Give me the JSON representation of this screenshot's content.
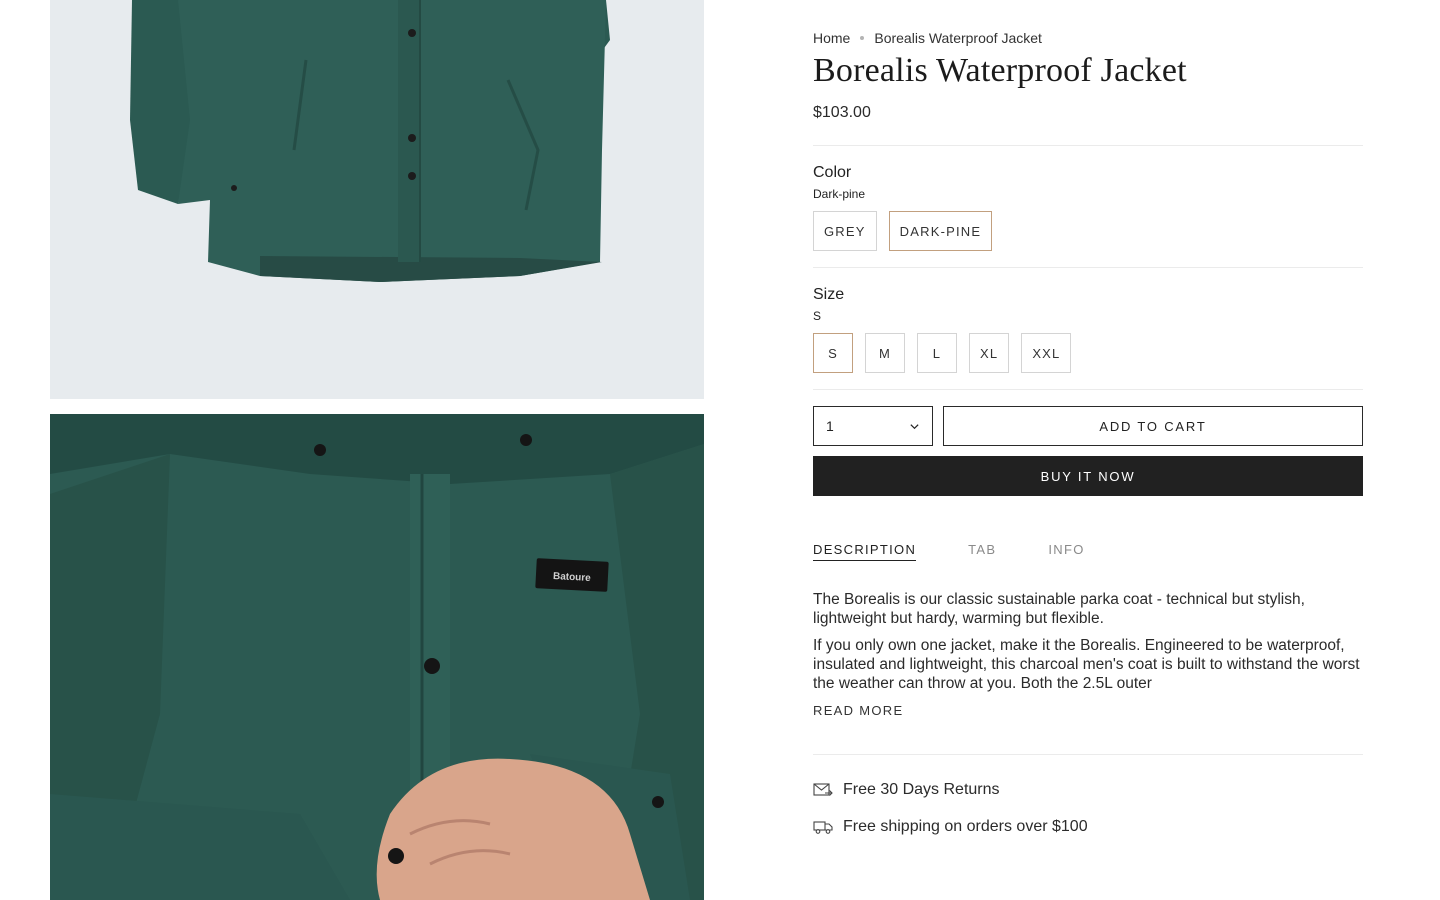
{
  "breadcrumb": {
    "home": "Home",
    "current": "Borealis Waterproof Jacket"
  },
  "product": {
    "title": "Borealis Waterproof Jacket",
    "price": "$103.00"
  },
  "gallery": {
    "logo_text": "Batoure"
  },
  "color_option": {
    "label": "Color",
    "selected": "Dark-pine",
    "choices": [
      "GREY",
      "DARK-PINE"
    ],
    "selected_index": 1
  },
  "size_option": {
    "label": "Size",
    "selected": "S",
    "choices": [
      "S",
      "M",
      "L",
      "XL",
      "XXL"
    ],
    "selected_index": 0
  },
  "purchase": {
    "quantity": "1",
    "add_to_cart": "ADD TO CART",
    "buy_now": "BUY IT NOW"
  },
  "tabs": [
    {
      "label": "DESCRIPTION",
      "active": true
    },
    {
      "label": "TAB",
      "active": false
    },
    {
      "label": "INFO",
      "active": false
    }
  ],
  "description": {
    "paragraphs": [
      "The Borealis is our classic sustainable parka coat - technical but stylish, lightweight but hardy, warming but flexible.",
      "If you only own one jacket, make it the Borealis. Engineered to be waterproof, insulated and lightweight, this charcoal men's coat is built to withstand the worst the weather can throw at you. Both the 2.5L outer"
    ],
    "read_more": "READ MORE"
  },
  "perks": [
    {
      "icon": "returns-envelope-icon",
      "text": "Free 30 Days Returns"
    },
    {
      "icon": "delivery-truck-icon",
      "text": "Free shipping on orders over $100"
    }
  ],
  "colors": {
    "jacket": "#2e5d55",
    "jacket_shadow": "#234b44",
    "photo_bg": "#e7ebee",
    "selected_border": "#c2a07f",
    "buy_now_bg": "#212121"
  }
}
